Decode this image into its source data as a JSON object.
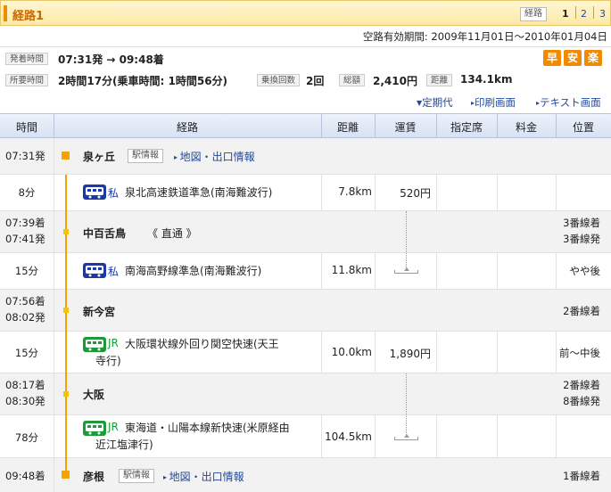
{
  "header": {
    "route_title": "経路1",
    "route_tag": "経路",
    "pages": [
      "1",
      "2",
      "3"
    ]
  },
  "validity": "空路有効期間: 2009年11月01日～2010年01月04日",
  "summary": {
    "depart_arrive_label": "発着時間",
    "depart_arrive_value": "07:31発 → 09:48着",
    "duration_label": "所要時間",
    "duration_value": "2時間17分(乗車時間: 1時間56分)",
    "transfers_label": "乗換回数",
    "transfers_value": "2回",
    "fare_label": "総額",
    "fare_value": "2,410円",
    "distance_label": "距離",
    "distance_value": "134.1km",
    "badges": [
      "早",
      "安",
      "楽"
    ]
  },
  "links": {
    "pass": "定期代",
    "print": "印刷画面",
    "text": "テキスト画面"
  },
  "columns": [
    "時間",
    "経路",
    "距離",
    "運賃",
    "指定席",
    "料金",
    "位置"
  ],
  "stations": [
    {
      "name": "泉ヶ丘",
      "times": [
        "07:31発"
      ],
      "info": "駅情報",
      "map": "地図・出口情報",
      "platform": []
    },
    {
      "name": "中百舌鳥",
      "times": [
        "07:39着",
        "07:41発"
      ],
      "direct": "《 直通 》",
      "platform": [
        "3番線着",
        "3番線発"
      ]
    },
    {
      "name": "新今宮",
      "times": [
        "07:56着",
        "08:02発"
      ],
      "platform": [
        "2番線着"
      ]
    },
    {
      "name": "大阪",
      "times": [
        "08:17着",
        "08:30発"
      ],
      "platform": [
        "2番線着",
        "8番線発"
      ]
    },
    {
      "name": "彦根",
      "times": [
        "09:48着"
      ],
      "info": "駅情報",
      "map": "地図・出口情報",
      "platform": [
        "1番線着"
      ]
    }
  ],
  "segments": [
    {
      "duration": "8分",
      "type": "私",
      "kind": "private",
      "name": [
        "泉北高速鉄道準急(南海難波行)"
      ],
      "distance": "7.8km",
      "fare": "520円",
      "position": ""
    },
    {
      "duration": "15分",
      "type": "私",
      "kind": "private",
      "name": [
        "南海高野線準急(南海難波行)"
      ],
      "distance": "11.8km",
      "fare": "",
      "position": "やや後"
    },
    {
      "duration": "15分",
      "type": "JR",
      "kind": "jr",
      "name": [
        "大阪環状線外回り関空快速(天王",
        "寺行)"
      ],
      "distance": "10.0km",
      "fare": "1,890円",
      "position": "前～中後"
    },
    {
      "duration": "78分",
      "type": "JR",
      "kind": "jr",
      "name": [
        "東海道・山陽本線新快速(米原経由",
        "近江塩津行)"
      ],
      "distance": "104.5km",
      "fare": "",
      "position": ""
    }
  ],
  "colors": {
    "accent": "#f08a00",
    "link": "#224a99",
    "private": "#1c39a8",
    "jr": "#1f9a3a"
  }
}
